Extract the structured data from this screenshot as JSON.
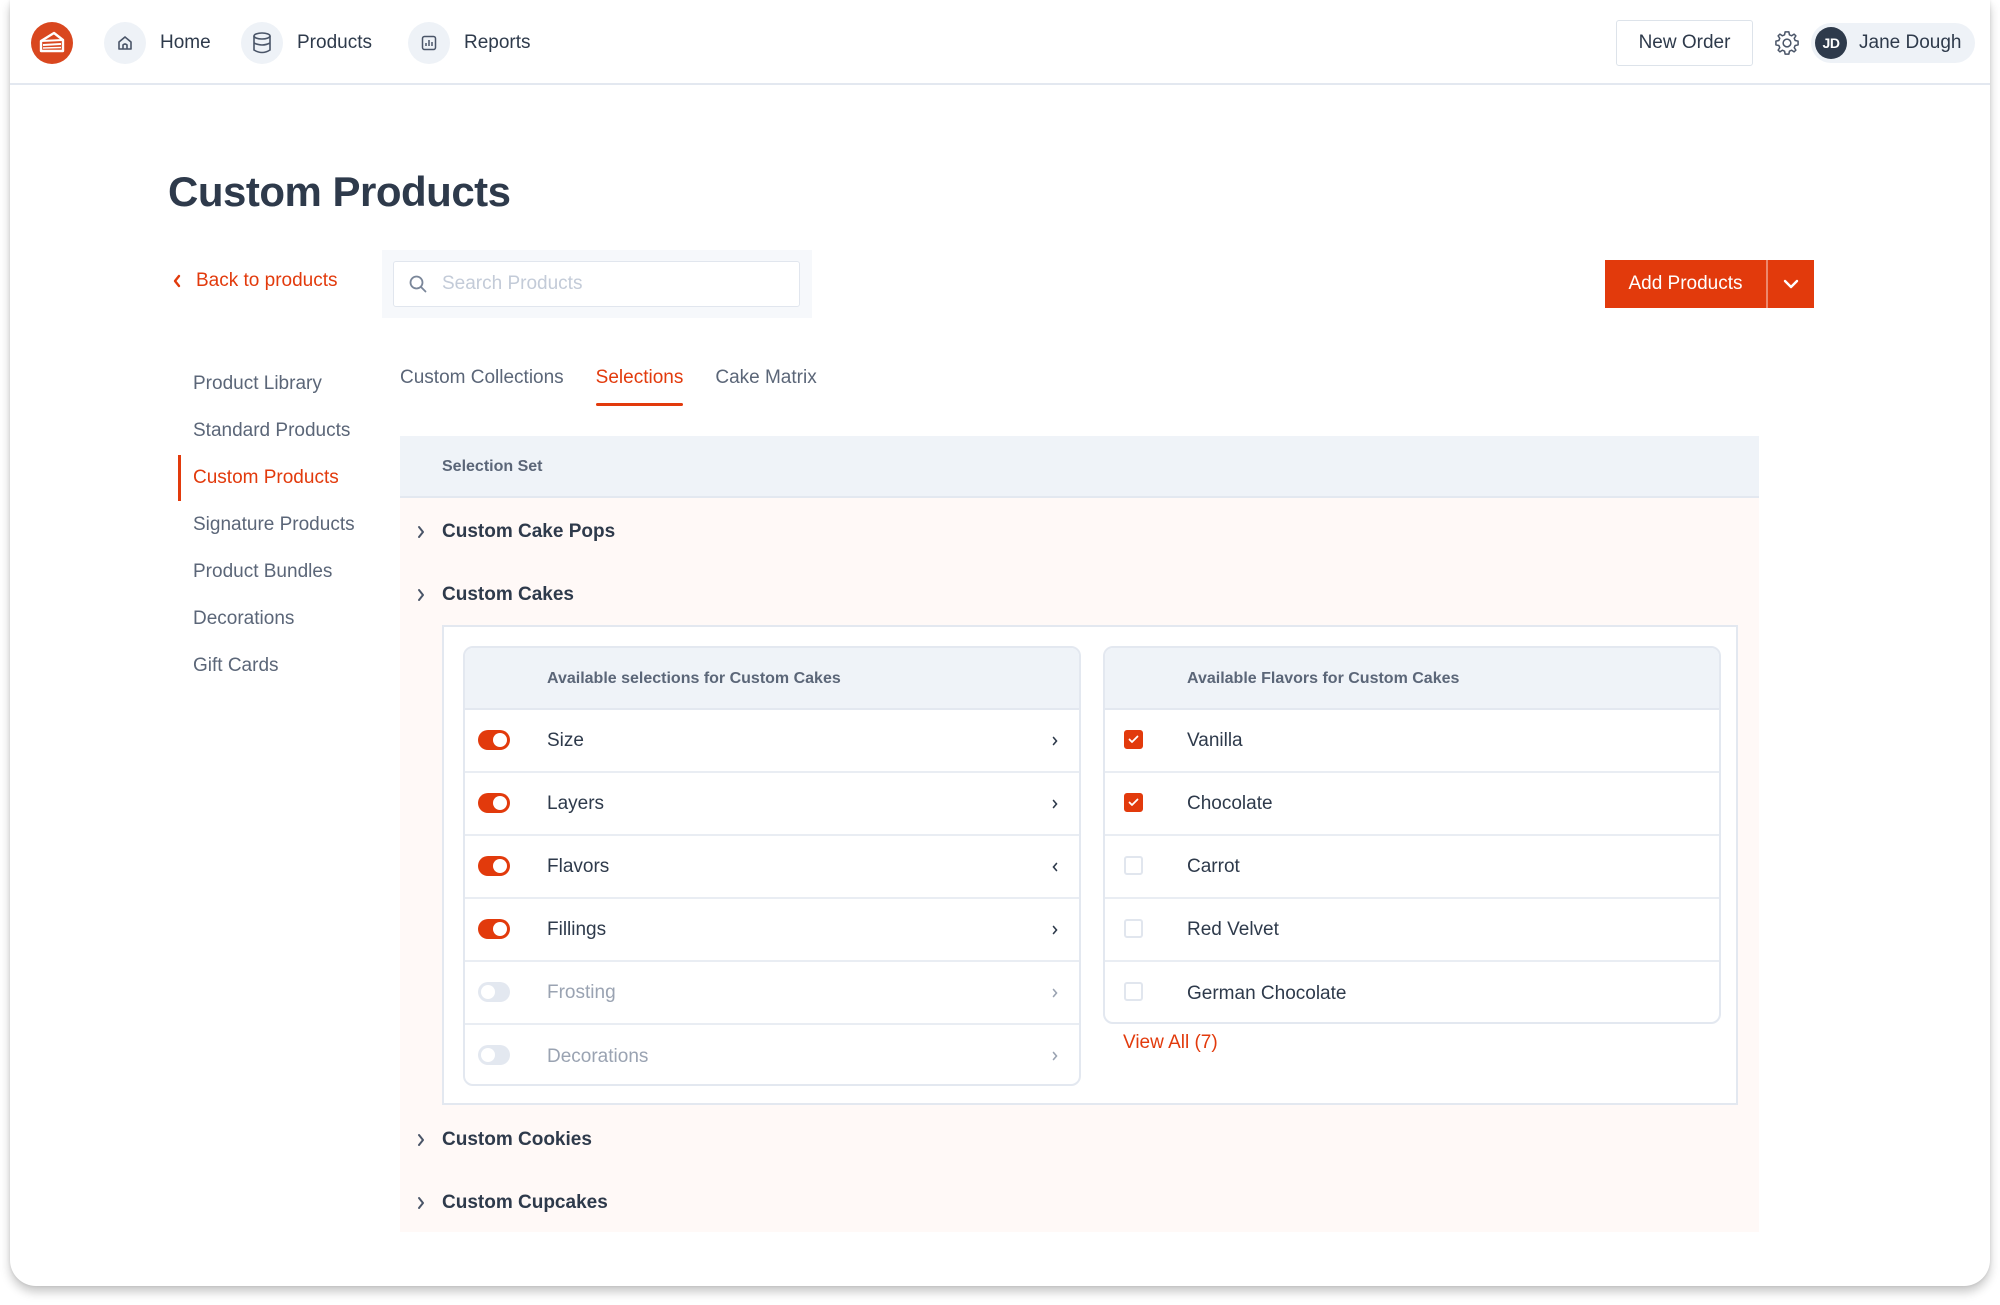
{
  "brand": {
    "accent": "#e23a0c",
    "logo_icon": "cake-slice-icon"
  },
  "topnav": {
    "items": [
      {
        "label": "Home",
        "icon": "home-icon"
      },
      {
        "label": "Products",
        "icon": "database-icon"
      },
      {
        "label": "Reports",
        "icon": "bar-chart-icon"
      }
    ],
    "new_order_label": "New Order",
    "settings_icon": "gear-icon",
    "user": {
      "initials": "JD",
      "name": "Jane Dough"
    }
  },
  "page": {
    "title": "Custom Products",
    "back_label": "Back to products",
    "search_placeholder": "Search Products",
    "search_value": "",
    "add_products_label": "Add Products"
  },
  "sidenav": {
    "items": [
      {
        "label": "Product Library",
        "active": false
      },
      {
        "label": "Standard Products",
        "active": false
      },
      {
        "label": "Custom Products",
        "active": true
      },
      {
        "label": "Signature Products",
        "active": false
      },
      {
        "label": "Product Bundles",
        "active": false
      },
      {
        "label": "Decorations",
        "active": false
      },
      {
        "label": "Gift Cards",
        "active": false
      }
    ]
  },
  "tabs": [
    {
      "label": "Custom Collections",
      "active": false
    },
    {
      "label": "Selections",
      "active": true
    },
    {
      "label": "Cake Matrix",
      "active": false
    }
  ],
  "selection_table": {
    "header": "Selection Set",
    "groups": [
      {
        "label": "Custom Cake Pops",
        "expanded": false
      },
      {
        "label": "Custom Cakes",
        "expanded": true
      },
      {
        "label": "Custom Cookies",
        "expanded": false
      },
      {
        "label": "Custom Cupcakes",
        "expanded": false
      }
    ],
    "expanded": {
      "selections_header": "Available selections for Custom Cakes",
      "selections": [
        {
          "label": "Size",
          "enabled": true,
          "chevron": "right"
        },
        {
          "label": "Layers",
          "enabled": true,
          "chevron": "right"
        },
        {
          "label": "Flavors",
          "enabled": true,
          "chevron": "left"
        },
        {
          "label": "Fillings",
          "enabled": true,
          "chevron": "right"
        },
        {
          "label": "Frosting",
          "enabled": false,
          "chevron": "right"
        },
        {
          "label": "Decorations",
          "enabled": false,
          "chevron": "right"
        }
      ],
      "flavors_header": "Available Flavors for Custom Cakes",
      "flavors": [
        {
          "label": "Vanilla",
          "checked": true
        },
        {
          "label": "Chocolate",
          "checked": true
        },
        {
          "label": "Carrot",
          "checked": false
        },
        {
          "label": "Red Velvet",
          "checked": false
        },
        {
          "label": "German Chocolate",
          "checked": false
        }
      ],
      "view_all_label": "View All (7)"
    }
  }
}
